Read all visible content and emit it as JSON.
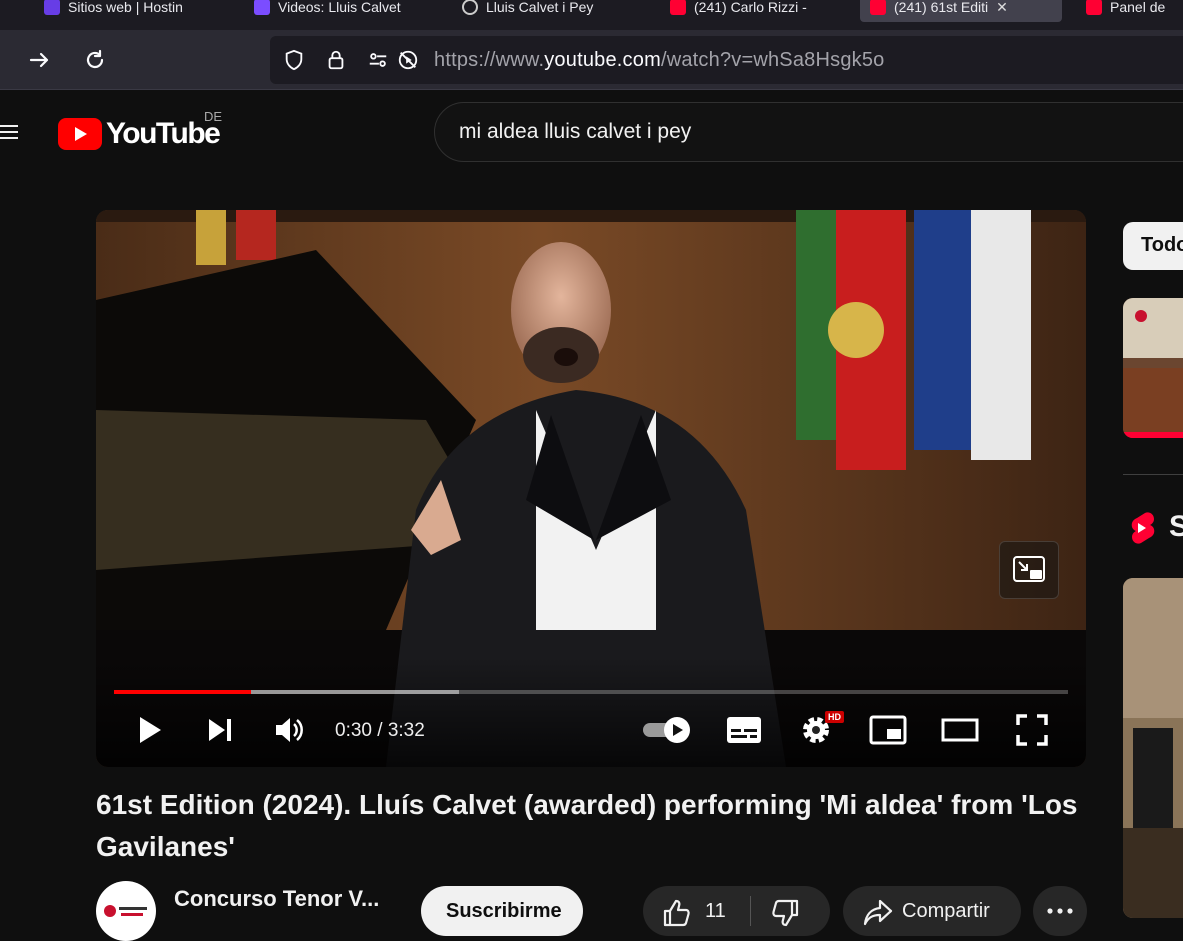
{
  "browser": {
    "tabs": [
      {
        "title": "Sitios web | Hostin",
        "color": "#673de6"
      },
      {
        "title": "Videos: Lluis Calvet",
        "color": "#7b4dff"
      },
      {
        "title": "Lluis Calvet i Pey",
        "color": "#888888"
      },
      {
        "title": "(241) Carlo Rizzi -",
        "color": "#ff0033"
      },
      {
        "title": "(241) 61st Editi",
        "color": "#ff0033"
      },
      {
        "title": "Panel de",
        "color": "#ff0033"
      }
    ],
    "url_prefix": "https://www.",
    "url_host": "youtube.com",
    "url_path": "/watch?v=whSa8Hsgk5o"
  },
  "youtube": {
    "logo_text": "YouTube",
    "country_code": "DE",
    "search_query": "mi aldea lluis calvet i pey"
  },
  "player": {
    "time_display": "0:30 / 3:32",
    "played_fraction": 0.1431,
    "buffered_fraction": 0.3616,
    "quality_badge": "HD"
  },
  "video": {
    "title": "61st Edition (2024). Lluís Calvet (awarded) performing 'Mi aldea' from 'Los Gavilanes'",
    "channel_name": "Concurso Tenor V...",
    "subscribe_label": "Suscribirme",
    "like_count": "11",
    "share_label": "Compartir"
  },
  "sidebar": {
    "chip_label": "Todo",
    "shorts_label": "S"
  },
  "colors": {
    "accent": "#ff0000",
    "background": "#0f0f0f"
  }
}
